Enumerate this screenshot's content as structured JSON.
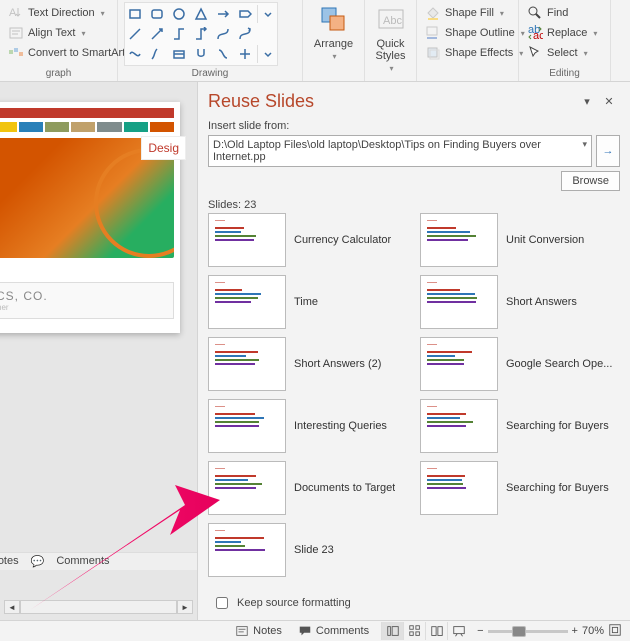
{
  "ribbon": {
    "paragraph": {
      "text_direction": "Text Direction",
      "align_text": "Align Text",
      "convert_smartart": "Convert to SmartArt",
      "group_label": "graph"
    },
    "drawing": {
      "arrange": "Arrange",
      "quick_styles": "Quick\nStyles",
      "shape_fill": "Shape Fill",
      "shape_outline": "Shape Outline",
      "shape_effects": "Shape Effects",
      "group_label": "Drawing"
    },
    "editing": {
      "find": "Find",
      "replace": "Replace",
      "select": "Select",
      "group_label": "Editing"
    }
  },
  "canvas": {
    "design_label": "Desig",
    "caption_title": "ANICS, CO.",
    "caption_sub": "s together",
    "mini_notes": "Notes",
    "mini_comments": "Comments"
  },
  "reuse": {
    "title": "Reuse Slides",
    "insert_from": "Insert slide from:",
    "path": "D:\\Old Laptop Files\\old laptop\\Desktop\\Tips on Finding Buyers over Internet.pp",
    "browse": "Browse",
    "count_label": "Slides: 23",
    "keep_label": "Keep source formatting",
    "slides": [
      {
        "left": "Currency Calculator",
        "right": "Unit Conversion"
      },
      {
        "left": "Time",
        "right": "Short Answers"
      },
      {
        "left": "Short Answers (2)",
        "right": "Google Search Ope..."
      },
      {
        "left": "Interesting Queries",
        "right": "Searching for Buyers"
      },
      {
        "left": "Documents to Target",
        "right": "Searching for Buyers"
      },
      {
        "left": "Slide 23",
        "right": ""
      }
    ]
  },
  "status": {
    "notes": "Notes",
    "comments": "Comments",
    "zoom_pct": "70%"
  }
}
